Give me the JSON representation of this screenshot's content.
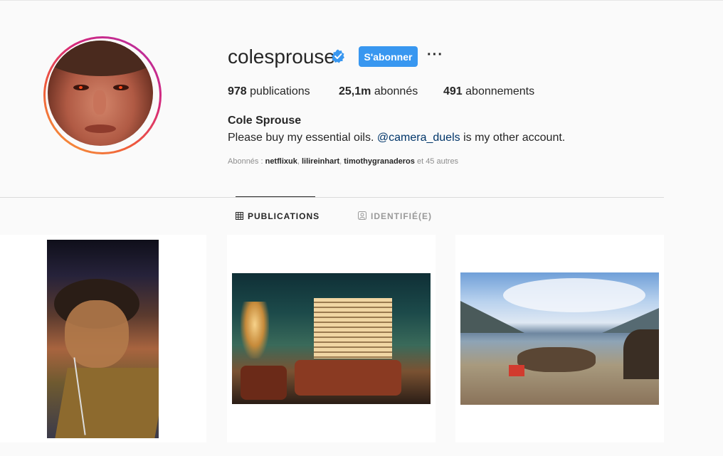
{
  "profile": {
    "username": "colesprouse",
    "verified": true,
    "follow_label": "S'abonner",
    "more_label": "···",
    "stats": {
      "posts_count": "978",
      "posts_label": " publications",
      "followers_count": "25,1m",
      "followers_label": " abonnés",
      "following_count": "491",
      "following_label": " abonnements"
    },
    "full_name": "Cole Sprouse",
    "bio_before": "Please buy my essential oils. ",
    "bio_mention": "@camera_duels",
    "bio_after": " is my other account.",
    "followed_by": {
      "prefix": "Abonnés : ",
      "names": [
        "netflixuk",
        "lilireinhart",
        "timothygranaderos"
      ],
      "sep1": ", ",
      "sep2": ", ",
      "suffix": " et 45 autres"
    }
  },
  "tabs": [
    {
      "label": "PUBLICATIONS",
      "icon": "grid-icon",
      "active": true
    },
    {
      "label": "IDENTIFIÉ(E)",
      "icon": "tagged-icon",
      "active": false
    }
  ],
  "posts": [
    {
      "icon": "portrait-photo"
    },
    {
      "icon": "office-interior-photo"
    },
    {
      "icon": "beach-photo"
    }
  ],
  "colors": {
    "accent": "#3897f0",
    "verified_blue": "#3897f0",
    "mention": "#003569"
  }
}
